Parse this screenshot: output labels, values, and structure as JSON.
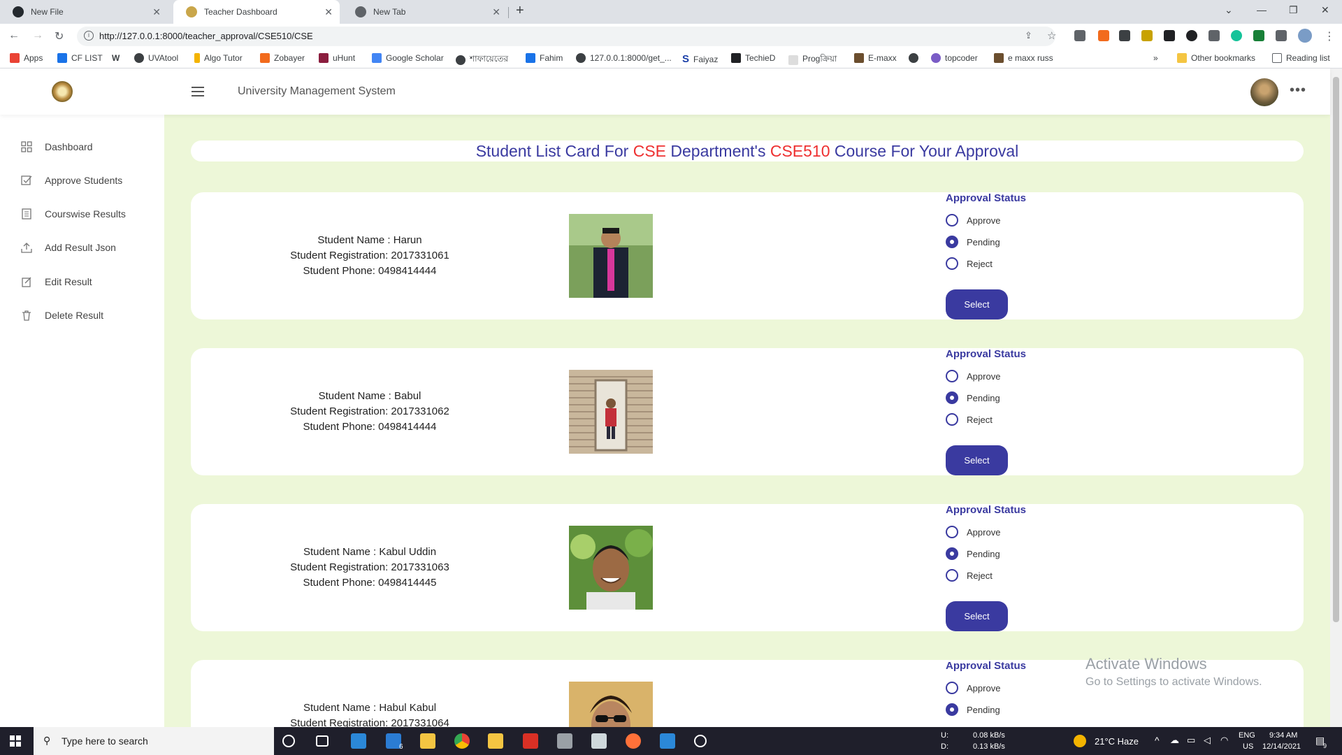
{
  "browser": {
    "tabs": [
      {
        "title": "New File"
      },
      {
        "title": "Teacher Dashboard"
      },
      {
        "title": "New Tab"
      }
    ],
    "url": "http://127.0.0.1:8000/teacher_approval/CSE510/CSE",
    "bookmarks": [
      "Apps",
      "CF LIST",
      "W",
      "UVAtool",
      "Algo Tutor",
      "Zobayer",
      "uHunt",
      "Google Scholar",
      "শাফায়েতের",
      "Fahim",
      "127.0.0.1:8000/get_...",
      "Faiyaz",
      "TechieD",
      "Progক্রিয়া",
      "E-maxx",
      "",
      "topcoder",
      "e maxx russ"
    ],
    "bookmarks_overflow": "»",
    "other_bookmarks": "Other bookmarks",
    "reading_list": "Reading list"
  },
  "app": {
    "title": "University Management System",
    "more": "•••"
  },
  "sidebar": {
    "items": [
      {
        "label": "Dashboard",
        "icon": "grid-icon"
      },
      {
        "label": "Approve Students",
        "icon": "checkbox-icon"
      },
      {
        "label": "Courswise Results",
        "icon": "document-icon"
      },
      {
        "label": "Add Result Json",
        "icon": "upload-icon"
      },
      {
        "label": "Edit Result",
        "icon": "edit-icon"
      },
      {
        "label": "Delete Result",
        "icon": "trash-icon"
      }
    ]
  },
  "page": {
    "title_prefix": "Student List Card For ",
    "dept": "CSE",
    "title_mid": " Department's ",
    "course": "CSE510",
    "title_suffix": " Course For Your Approval"
  },
  "approval": {
    "title": "Approval Status",
    "options": [
      "Approve",
      "Pending",
      "Reject"
    ],
    "button": "Select"
  },
  "students": [
    {
      "name": "Student Name : Harun",
      "reg": "Student Registration: 2017331061",
      "phone": "Student Phone: 0498414444",
      "status": "Pending"
    },
    {
      "name": "Student Name : Babul",
      "reg": "Student Registration: 2017331062",
      "phone": "Student Phone: 0498414444",
      "status": "Pending"
    },
    {
      "name": "Student Name : Kabul Uddin",
      "reg": "Student Registration: 2017331063",
      "phone": "Student Phone: 0498414445",
      "status": "Pending"
    },
    {
      "name": "Student Name : Habul Kabul",
      "reg": "Student Registration: 2017331064",
      "phone": "",
      "status": "Pending"
    }
  ],
  "watermark": {
    "line1": "Activate Windows",
    "line2": "Go to Settings to activate Windows."
  },
  "taskbar": {
    "search_placeholder": "Type here to search",
    "net_up_label": "U:",
    "net_up": "0.08 kB/s",
    "net_down_label": "D:",
    "net_down": "0.13 kB/s",
    "weather": "21°C  Haze",
    "lang": "ENG",
    "region": "US",
    "time": "9:34 AM",
    "date": "12/14/2021",
    "mail_badge": "6",
    "notif_badge": "9"
  },
  "colors": {
    "accent": "#3a3aa0",
    "highlight": "#ee3030",
    "main_bg": "#edf7d8"
  }
}
